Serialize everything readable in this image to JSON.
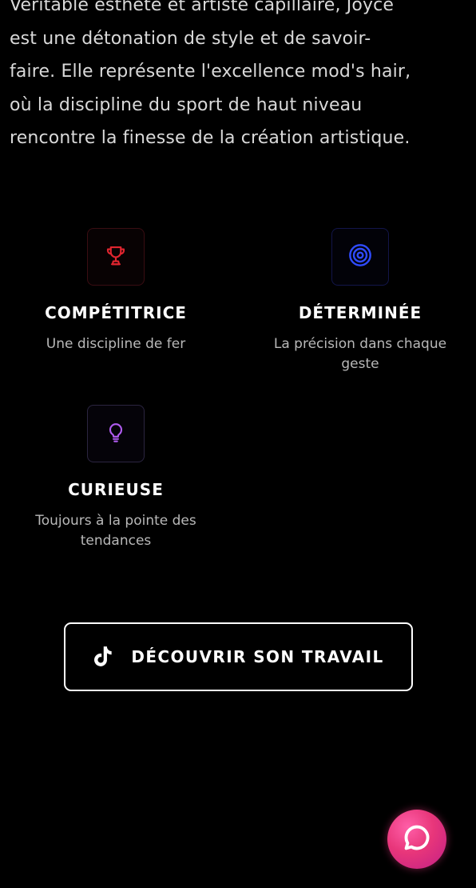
{
  "intro": {
    "lines": [
      "Véritable esthète et artiste capillaire, Joyce",
      "est une détonation de style et de savoir-",
      "faire. Elle représente l'excellence mod's hair,",
      "où la discipline du sport de haut niveau",
      "rencontre la finesse de la création artistique."
    ]
  },
  "traits": [
    {
      "icon": "trophy-icon",
      "icon_color": "#e0252f",
      "title": "COMPÉTITRICE",
      "desc_lines": [
        "Une discipline de fer"
      ]
    },
    {
      "icon": "target-icon",
      "icon_color": "#2f4bff",
      "title": "DÉTERMINÉE",
      "desc_lines": [
        "La précision dans chaque",
        "geste"
      ]
    },
    {
      "icon": "lightbulb-icon",
      "icon_color": "#b05cf0",
      "title": "CURIEUSE",
      "desc_lines": [
        "Toujours à la pointe des",
        "tendances"
      ]
    }
  ],
  "cta": {
    "icon": "tiktok-icon",
    "label": "DÉCOUVRIR SON TRAVAIL"
  },
  "chat": {
    "icon": "chat-bubble-icon",
    "color": "#e8367a"
  }
}
